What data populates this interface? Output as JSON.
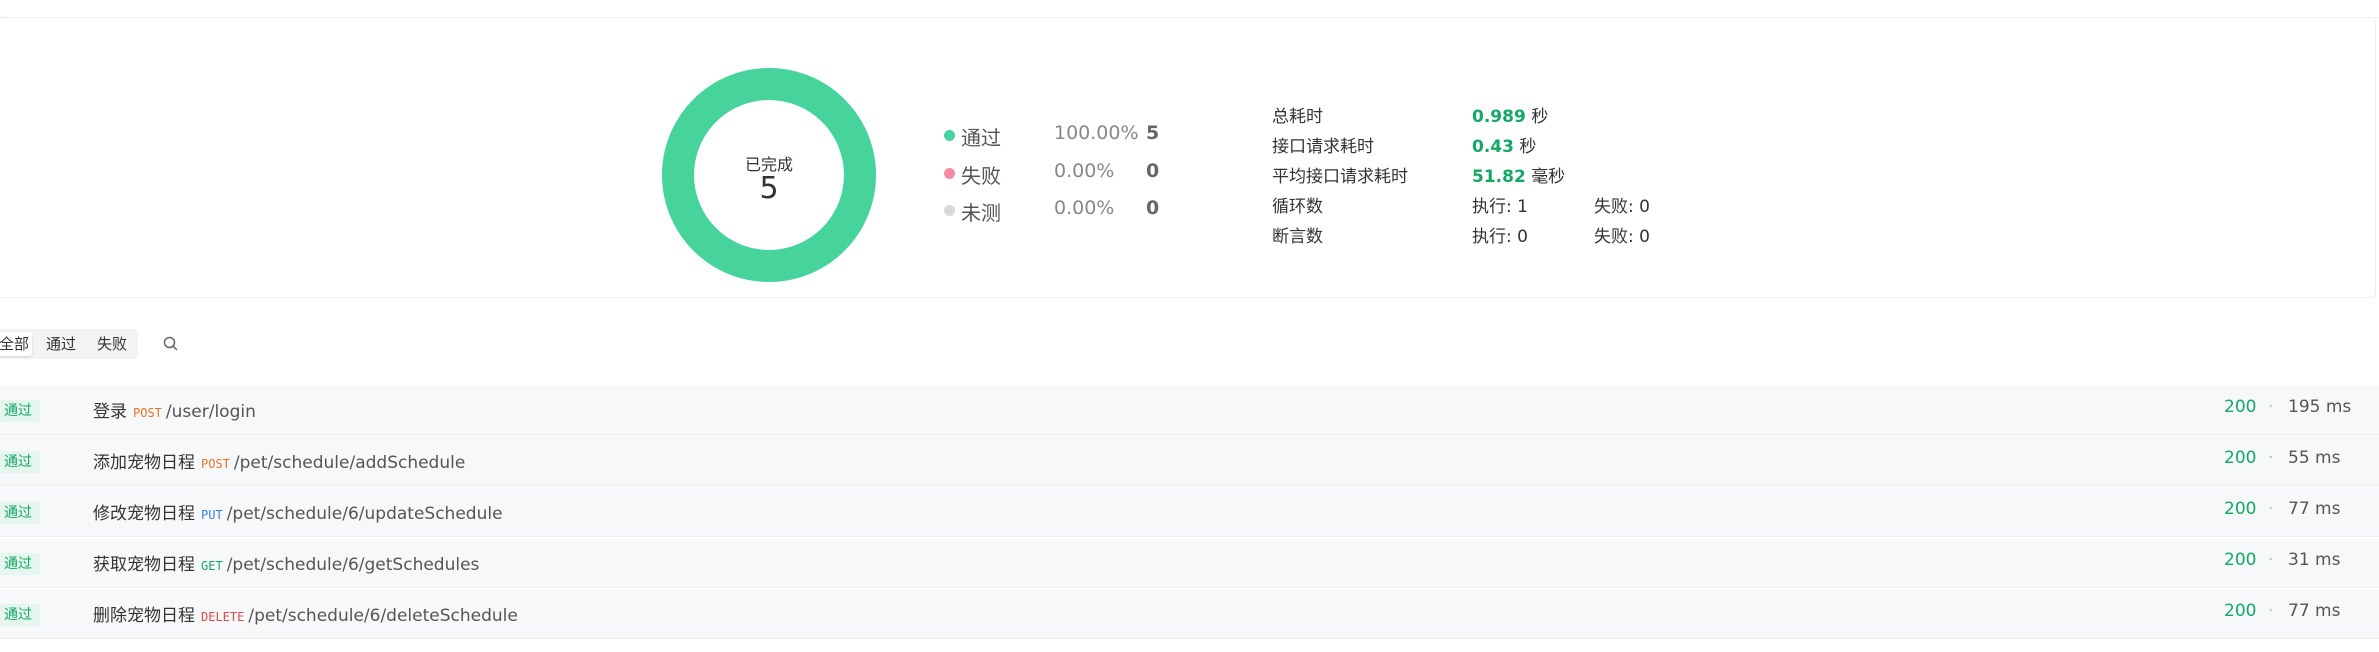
{
  "summary": {
    "donut": {
      "title": "已完成",
      "count": "5",
      "pass_fraction": 1.0,
      "color": "#46d49c"
    },
    "legend": [
      {
        "name": "通过",
        "percent": "100.00%",
        "count": "5",
        "color": "#46d49c"
      },
      {
        "name": "失败",
        "percent": "0.00%",
        "count": "0",
        "color": "#f28ba3"
      },
      {
        "name": "未测",
        "percent": "0.00%",
        "count": "0",
        "color": "#d9d9d9"
      }
    ],
    "stats": [
      {
        "label": "总耗时",
        "value": "0.989",
        "unit": "秒"
      },
      {
        "label": "接口请求耗时",
        "value": "0.43",
        "unit": "秒"
      },
      {
        "label": "平均接口请求耗时",
        "value": "51.82",
        "unit": "毫秒"
      }
    ],
    "loops": {
      "label": "循环数",
      "exec": "执行: 1",
      "fail": "失败: 0"
    },
    "asserts": {
      "label": "断言数",
      "exec": "执行: 0",
      "fail": "失败: 0"
    }
  },
  "filters": {
    "all": "全部",
    "pass": "通过",
    "fail": "失败"
  },
  "requests": [
    {
      "badge": "通过",
      "name": "登录",
      "method": "POST",
      "method_color": "#e8722a",
      "path": "/user/login",
      "status": "200",
      "time": "195 ms"
    },
    {
      "badge": "通过",
      "name": "添加宠物日程",
      "method": "POST",
      "method_color": "#e8722a",
      "path": "/pet/schedule/addSchedule",
      "status": "200",
      "time": "55 ms"
    },
    {
      "badge": "通过",
      "name": "修改宠物日程",
      "method": "PUT",
      "method_color": "#3b82d6",
      "path": "/pet/schedule/6/updateSchedule",
      "status": "200",
      "time": "77 ms"
    },
    {
      "badge": "通过",
      "name": "获取宠物日程",
      "method": "GET",
      "method_color": "#13a865",
      "path": "/pet/schedule/6/getSchedules",
      "status": "200",
      "time": "31 ms"
    },
    {
      "badge": "通过",
      "name": "删除宠物日程",
      "method": "DELETE",
      "method_color": "#e5484d",
      "path": "/pet/schedule/6/deleteSchedule",
      "status": "200",
      "time": "77 ms"
    }
  ],
  "separator": "·"
}
